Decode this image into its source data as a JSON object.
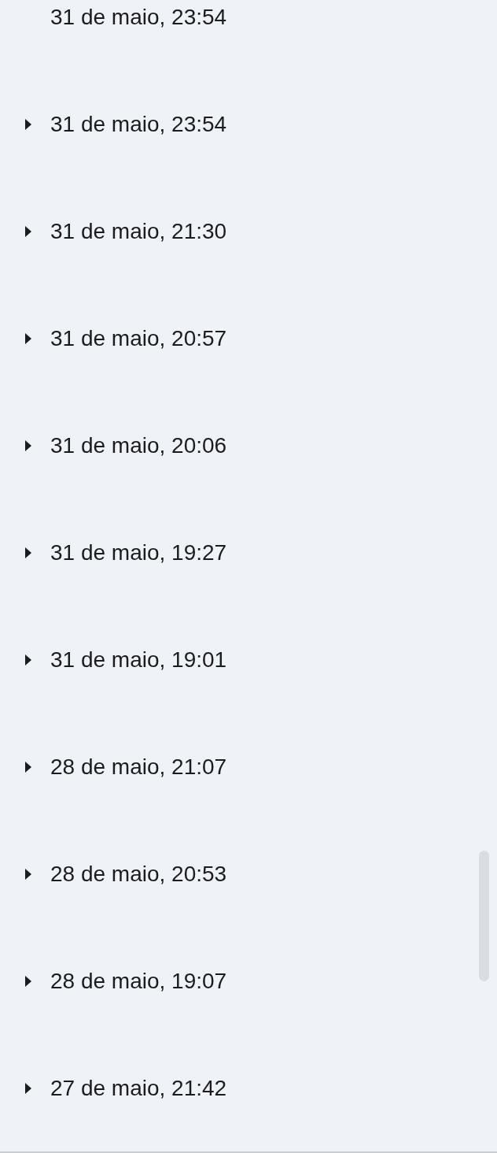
{
  "versions": [
    {
      "kind": "plain",
      "label": "31 de maio, 23:54"
    },
    {
      "kind": "collapsible",
      "label": "31 de maio, 23:54",
      "expanded": false
    },
    {
      "kind": "collapsible",
      "label": "31 de maio, 21:30",
      "expanded": false
    },
    {
      "kind": "collapsible",
      "label": "31 de maio, 20:57",
      "expanded": false
    },
    {
      "kind": "collapsible",
      "label": "31 de maio, 20:06",
      "expanded": false
    },
    {
      "kind": "collapsible",
      "label": "31 de maio, 19:27",
      "expanded": false
    },
    {
      "kind": "collapsible",
      "label": "31 de maio, 19:01",
      "expanded": false
    },
    {
      "kind": "collapsible",
      "label": "28 de maio, 21:07",
      "expanded": false
    },
    {
      "kind": "collapsible",
      "label": "28 de maio, 20:53",
      "expanded": false
    },
    {
      "kind": "collapsible",
      "label": "28 de maio, 19:07",
      "expanded": false
    },
    {
      "kind": "collapsible",
      "label": "27 de maio, 21:42",
      "expanded": false
    }
  ]
}
